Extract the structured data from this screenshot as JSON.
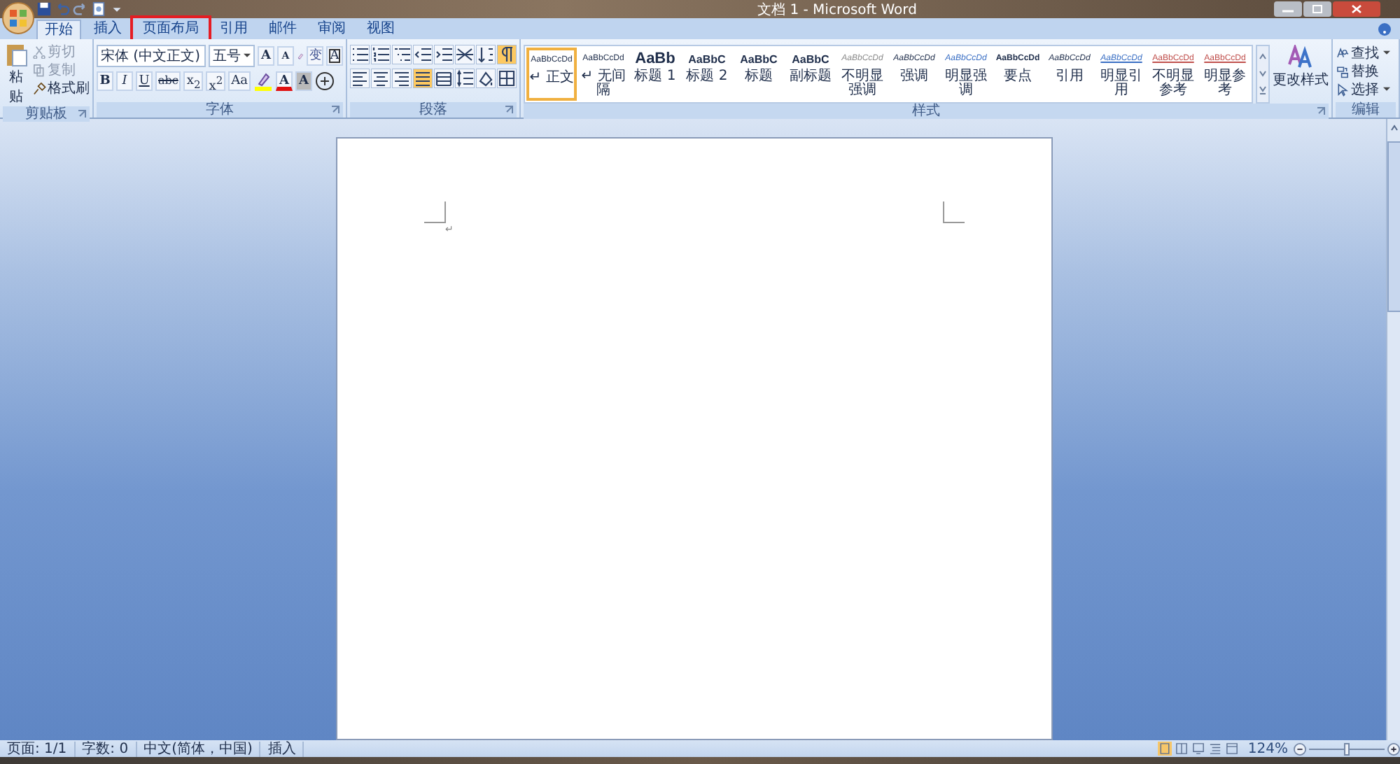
{
  "title_bar": {
    "title": "文档 1 - Microsoft Word"
  },
  "tabs": [
    {
      "label": "开始",
      "selected": true,
      "highlighted": false
    },
    {
      "label": "插入",
      "selected": false,
      "highlighted": false
    },
    {
      "label": "页面布局",
      "selected": false,
      "highlighted": true
    },
    {
      "label": "引用",
      "selected": false,
      "highlighted": false
    },
    {
      "label": "邮件",
      "selected": false,
      "highlighted": false
    },
    {
      "label": "审阅",
      "selected": false,
      "highlighted": false
    },
    {
      "label": "视图",
      "selected": false,
      "highlighted": false
    }
  ],
  "clipboard": {
    "label": "剪贴板",
    "paste": "粘贴",
    "items": [
      {
        "label": "剪切",
        "kind": "cut",
        "disabled": true
      },
      {
        "label": "复制",
        "kind": "copy",
        "disabled": true
      },
      {
        "label": "格式刷",
        "kind": "brush",
        "disabled": false
      }
    ]
  },
  "font": {
    "label": "字体",
    "face": "宋体 (中文正文)",
    "size": "五号",
    "row1": [
      {
        "kind": "grow",
        "label": "A"
      },
      {
        "kind": "shrink",
        "label": "A"
      },
      {
        "kind": "clear"
      },
      {
        "kind": "phonetic",
        "label": "变"
      },
      {
        "kind": "border",
        "label": "A"
      }
    ],
    "row2": [
      {
        "kind": "bold",
        "label": "B"
      },
      {
        "kind": "italic",
        "label": "I"
      },
      {
        "kind": "underline",
        "label": "U"
      },
      {
        "kind": "strike",
        "label": "abc"
      },
      {
        "kind": "sub",
        "label": "x$_{2}$"
      },
      {
        "kind": "sup",
        "label": "x$^{2}$"
      },
      {
        "kind": "case",
        "label": "Aa"
      },
      {
        "kind": "highlight"
      },
      {
        "kind": "color",
        "label": "A"
      },
      {
        "kind": "shade",
        "label": "A"
      },
      {
        "kind": "enclose"
      }
    ]
  },
  "paragraph": {
    "label": "段落",
    "row1": [
      {
        "kind": "bullets",
        "selected": false
      },
      {
        "kind": "numbers",
        "selected": false
      },
      {
        "kind": "multilevel",
        "selected": false
      },
      {
        "kind": "outdent",
        "selected": false
      },
      {
        "kind": "indent",
        "selected": false
      },
      {
        "kind": "layout",
        "selected": false
      },
      {
        "kind": "sort",
        "selected": false
      },
      {
        "kind": "marks",
        "selected": true
      }
    ],
    "row2": [
      {
        "kind": "left",
        "selected": false
      },
      {
        "kind": "center",
        "selected": false
      },
      {
        "kind": "right",
        "selected": false
      },
      {
        "kind": "justify",
        "selected": true
      },
      {
        "kind": "distribute",
        "selected": false
      },
      {
        "kind": "spacing",
        "selected": false
      },
      {
        "kind": "fill",
        "selected": false
      },
      {
        "kind": "borders",
        "selected": false
      }
    ]
  },
  "styles": {
    "label": "样式",
    "change_button": "更改样式",
    "items": [
      {
        "preview": "AaBbCcDd",
        "label": "↵ 正文",
        "kind": "normal",
        "selected": true
      },
      {
        "preview": "AaBbCcDd",
        "label": "↵ 无间隔",
        "kind": "normal",
        "selected": false
      },
      {
        "preview": "AaBb",
        "label": "标题 1",
        "kind": "h1",
        "selected": false
      },
      {
        "preview": "AaBbC",
        "label": "标题 2",
        "kind": "h2",
        "selected": false
      },
      {
        "preview": "AaBbC",
        "label": "标题",
        "kind": "h2",
        "selected": false
      },
      {
        "preview": "AaBbC",
        "label": "副标题",
        "kind": "h2",
        "selected": false
      },
      {
        "preview": "AaBbCcDd",
        "label": "不明显强调",
        "kind": "subtle",
        "selected": false
      },
      {
        "preview": "AaBbCcDd",
        "label": "强调",
        "kind": "emphasis",
        "selected": false
      },
      {
        "preview": "AaBbCcDd",
        "label": "明显强调",
        "kind": "intense",
        "selected": false
      },
      {
        "preview": "AaBbCcDd",
        "label": "要点",
        "kind": "strong",
        "selected": false
      },
      {
        "preview": "AaBbCcDd",
        "label": "引用",
        "kind": "emphasis",
        "selected": false
      },
      {
        "preview": "AaBbCcDd",
        "label": "明显引用",
        "kind": "quote",
        "selected": false
      },
      {
        "preview": "AaBbCcDd",
        "label": "不明显参考",
        "kind": "reference",
        "selected": false
      },
      {
        "preview": "AaBbCcDd",
        "label": "明显参考",
        "kind": "reference",
        "selected": false
      }
    ]
  },
  "editing": {
    "label": "编辑",
    "items": [
      {
        "label": "查找",
        "kind": "find",
        "menu": true
      },
      {
        "label": "替换",
        "kind": "replace",
        "menu": false
      },
      {
        "label": "选择",
        "kind": "select",
        "menu": true
      }
    ]
  },
  "document": {
    "paragraph_mark": "↵"
  },
  "status_bar": {
    "items": [
      "页面: 1/1",
      "字数: 0",
      "中文(简体，中国)",
      "插入"
    ],
    "views": [
      {
        "selected": true
      },
      {
        "selected": false
      },
      {
        "selected": false
      },
      {
        "selected": false
      },
      {
        "selected": false
      }
    ],
    "zoom": "124%",
    "zoom_slider": {
      "level": 0.5
    }
  }
}
